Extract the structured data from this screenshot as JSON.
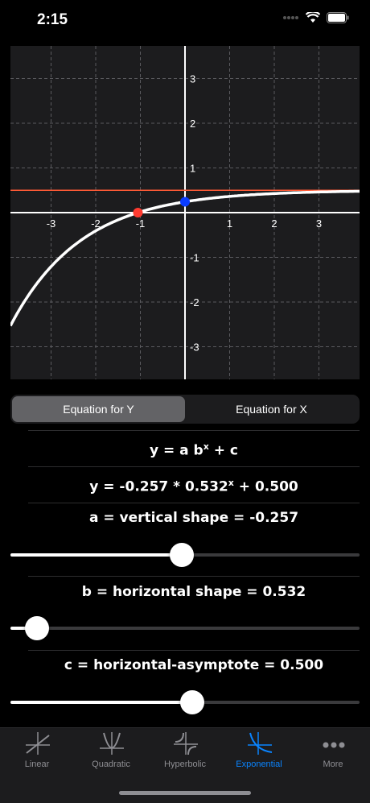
{
  "status": {
    "time": "2:15"
  },
  "graph": {
    "x_ticks": [
      "-3",
      "-2",
      "-1",
      "1",
      "2",
      "3"
    ],
    "y_ticks": [
      "3",
      "2",
      "1",
      "-1",
      "-2",
      "-3"
    ],
    "curve_color": "#ffffff",
    "asymptote_color": "#ff5a36",
    "x_intercept_color": "#ff3b30",
    "y_intercept_color": "#0a3cff"
  },
  "segmented": {
    "options": [
      "Equation for Y",
      "Equation for X"
    ],
    "selected": 0
  },
  "equation": {
    "general": "y = a b",
    "general_exp": "x",
    "general_tail": " + c",
    "specific": "y = -0.257 * 0.532",
    "specific_exp": "x",
    "specific_tail": " + 0.500"
  },
  "params": {
    "a": {
      "label": "a = vertical shape = -0.257",
      "value": -0.257,
      "slider_fraction": 0.49
    },
    "b": {
      "label": "b = horizontal shape = 0.532",
      "value": 0.532,
      "slider_fraction": 0.075
    },
    "c": {
      "label": "c = horizontal-asymptote = 0.500",
      "value": 0.5,
      "slider_fraction": 0.52
    }
  },
  "tabs": [
    {
      "label": "Linear",
      "icon": "linear-graph-icon"
    },
    {
      "label": "Quadratic",
      "icon": "quadratic-graph-icon"
    },
    {
      "label": "Hyperbolic",
      "icon": "hyperbolic-graph-icon"
    },
    {
      "label": "Exponential",
      "icon": "exponential-graph-icon"
    },
    {
      "label": "More",
      "icon": "more-dots-icon"
    }
  ],
  "active_tab": 3,
  "accent_color": "#0a84ff"
}
